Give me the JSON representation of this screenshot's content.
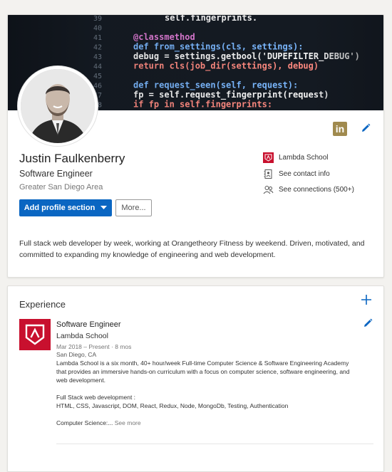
{
  "profile": {
    "name": "Justin Faulkenberry",
    "headline": "Software Engineer",
    "location": "Greater San Diego Area",
    "add_section_label": "Add profile section",
    "more_label": "More...",
    "school": "Lambda School",
    "contact_label": "See contact info",
    "connections_label": "See connections (500+)",
    "summary": "Full stack web developer by week, working at Orangetheory Fitness by weekend. Driven, motivated, and committed to expanding my knowledge of engineering and web development.",
    "linkedin_icon_text": "in"
  },
  "banner": {
    "line_numbers": [
      "39",
      "40",
      "41",
      "42",
      "43",
      "44",
      "45",
      "46",
      "47",
      "48"
    ],
    "code_lines": [
      "self.fingerprints.",
      "",
      "@classmethod",
      "def from_settings(cls, settings):",
      "    debug = settings.getbool('DUPEFILTER_DEBUG')",
      "    return cls(job_dir(settings), debug)",
      "",
      "def request_seen(self, request):",
      "    fp = self.request_fingerprint(request)",
      "    if fp in self.fingerprints:"
    ]
  },
  "experience": {
    "section_title": "Experience",
    "items": [
      {
        "title": "Software Engineer",
        "company": "Lambda School",
        "dates": "Mar 2018 – Present · 8 mos",
        "location": "San Diego, CA",
        "description_1": "Lambda School is a six month, 40+ hour/week Full-time Computer Science & Software Engineering Academy that provides an immersive hands-on curriculum with a focus on computer science, software engineering, and web development.",
        "description_2_title": "Full Stack web development :",
        "description_2": "HTML, CSS, Javascript, DOM, React, Redux, Node, MongoDb, Testing, Authentication",
        "description_3": "Computer Science:...",
        "see_more": "See more"
      }
    ]
  },
  "colors": {
    "accent": "#0a66c2",
    "school_red": "#c8102e",
    "linkedin_gold": "#a08a4e"
  }
}
